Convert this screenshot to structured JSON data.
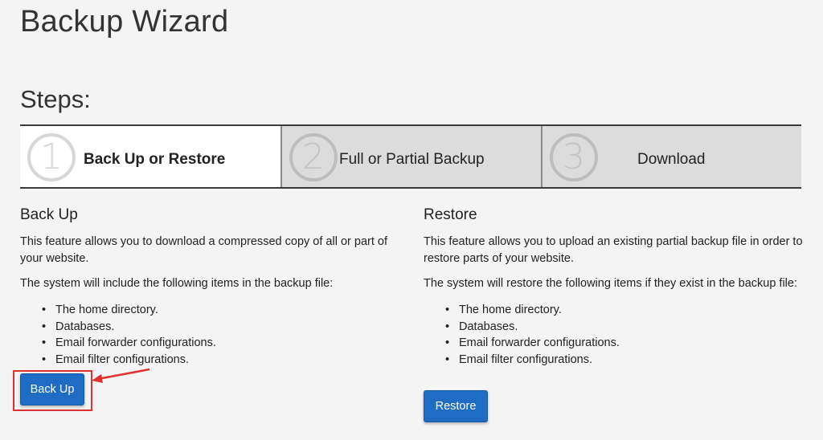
{
  "page_title": "Backup Wizard",
  "steps_heading": "Steps:",
  "steps": [
    {
      "number": "1",
      "label": "Back Up or Restore",
      "active": true
    },
    {
      "number": "2",
      "label": "Full or Partial Backup",
      "active": false
    },
    {
      "number": "3",
      "label": "Download",
      "active": false
    }
  ],
  "backup": {
    "heading": "Back Up",
    "description": "This feature allows you to download a compressed copy of all or part of your website.",
    "intro": "The system will include the following items in the backup file:",
    "items": [
      "The home directory.",
      "Databases.",
      "Email forwarder configurations.",
      "Email filter configurations."
    ],
    "button_label": "Back Up"
  },
  "restore": {
    "heading": "Restore",
    "description": "This feature allows you to upload an existing partial backup file in order to restore parts of your website.",
    "intro": "The system will restore the following items if they exist in the backup file:",
    "items": [
      "The home directory.",
      "Databases.",
      "Email forwarder configurations.",
      "Email filter configurations."
    ],
    "button_label": "Restore"
  },
  "colors": {
    "accent": "#1f6cc5",
    "annotation": "#e03030",
    "inactive_step_bg": "#dcdcdc"
  }
}
